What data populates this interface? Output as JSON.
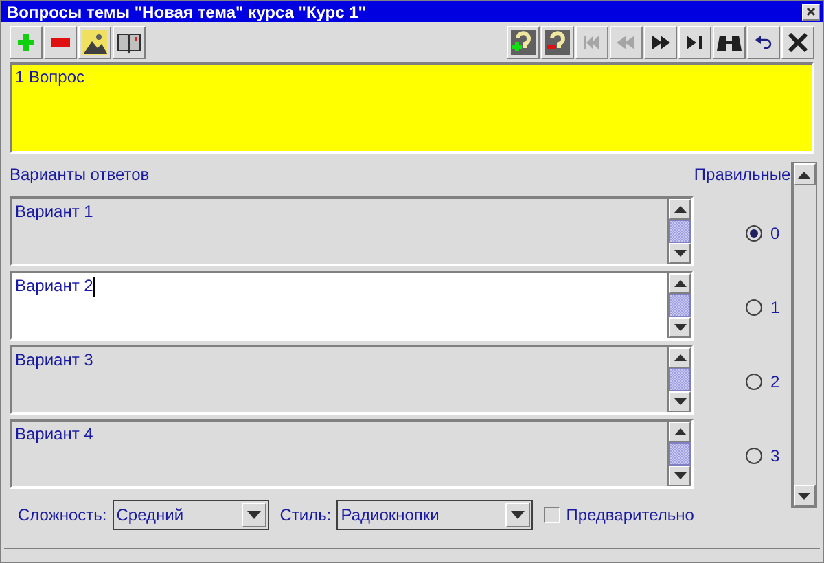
{
  "window": {
    "title": "Вопросы темы \"Новая тема\" курса \"Курс 1\""
  },
  "toolbar_left": [
    {
      "kind": "add",
      "disabled": false
    },
    {
      "kind": "remove",
      "disabled": false
    },
    {
      "kind": "image",
      "disabled": false
    },
    {
      "kind": "book",
      "disabled": false
    }
  ],
  "toolbar_right": [
    {
      "kind": "question-add",
      "disabled": false
    },
    {
      "kind": "question-remove",
      "disabled": false
    },
    {
      "kind": "first",
      "disabled": true
    },
    {
      "kind": "prev",
      "disabled": true
    },
    {
      "kind": "next",
      "disabled": false
    },
    {
      "kind": "last",
      "disabled": false
    },
    {
      "kind": "find",
      "disabled": false
    },
    {
      "kind": "undo",
      "disabled": false
    },
    {
      "kind": "close",
      "disabled": false
    }
  ],
  "question": {
    "value": "1 Вопрос"
  },
  "answers_label": "Варианты ответов",
  "correct_label": "Правильные",
  "answers": [
    {
      "value": "Вариант 1",
      "focused": false
    },
    {
      "value": "Вариант 2",
      "focused": true
    },
    {
      "value": "Вариант 3",
      "focused": false
    },
    {
      "value": "Вариант 4",
      "focused": false
    }
  ],
  "correct": [
    {
      "label": "0",
      "selected": true
    },
    {
      "label": "1",
      "selected": false
    },
    {
      "label": "2",
      "selected": false
    },
    {
      "label": "3",
      "selected": false
    }
  ],
  "difficulty": {
    "label": "Сложность:",
    "value": "Средний"
  },
  "style": {
    "label": "Стиль:",
    "value": "Радиокнопки"
  },
  "preliminary": {
    "label": "Предварительно",
    "checked": false
  }
}
